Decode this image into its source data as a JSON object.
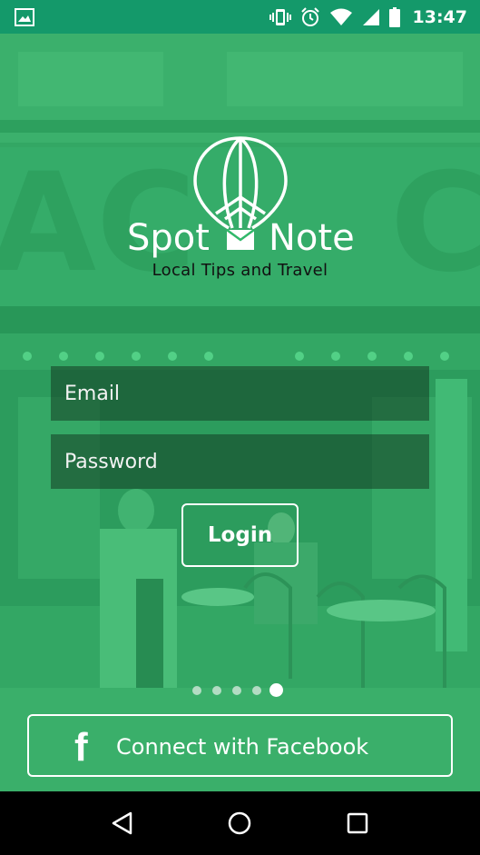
{
  "status_bar": {
    "time": "13:47",
    "icons": [
      "image-icon",
      "vibrate-icon",
      "alarm-icon",
      "wifi-icon",
      "signal-icon",
      "battery-icon"
    ]
  },
  "app": {
    "brand_left": "Spot",
    "brand_right": "Note",
    "tagline": "Local Tips and Travel"
  },
  "login_form": {
    "email_placeholder": "Email",
    "email_value": "",
    "password_placeholder": "Password",
    "password_value": "",
    "login_label": "Login"
  },
  "pager": {
    "count": 5,
    "active_index": 4
  },
  "facebook": {
    "icon_glyph": "f",
    "label": "Connect with Facebook"
  },
  "nav_bar": {
    "icons": [
      "back-icon",
      "home-icon",
      "recents-icon"
    ]
  },
  "colors": {
    "status_bar": "#14996a",
    "overlay_green": "#2ecc71",
    "field_bg": "#143c23",
    "white": "#ffffff",
    "nav_bar": "#000000"
  }
}
